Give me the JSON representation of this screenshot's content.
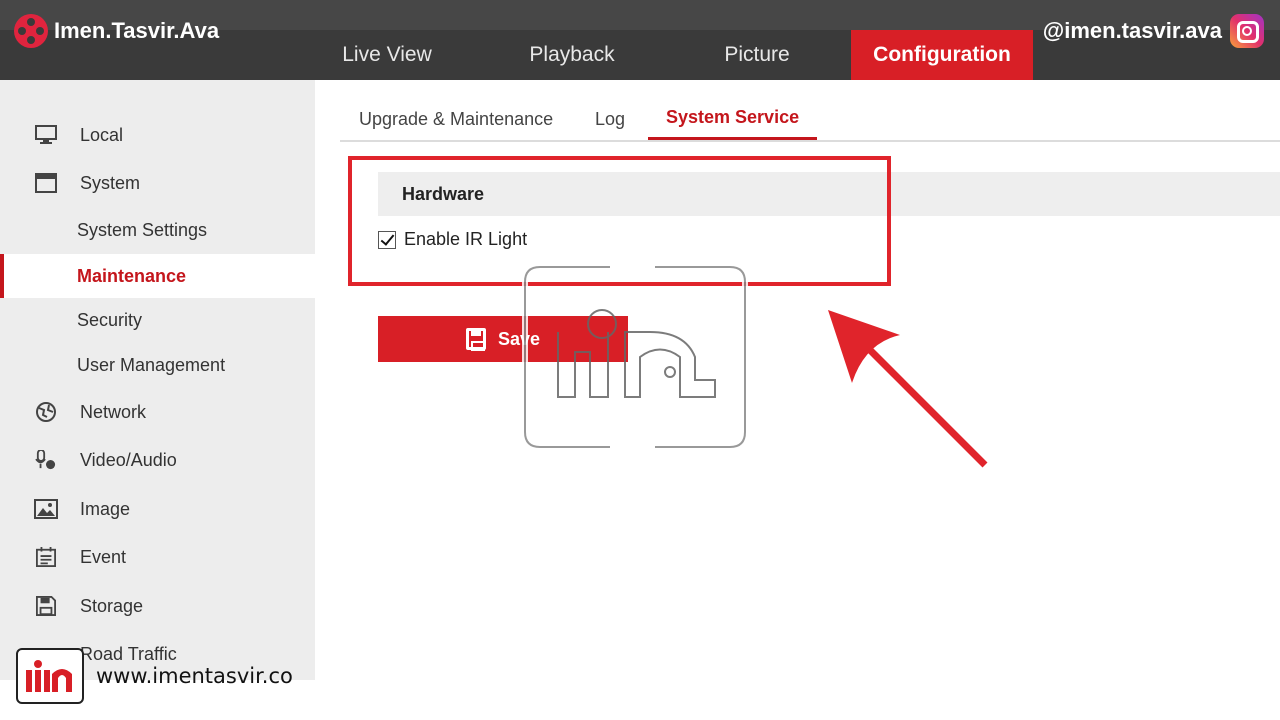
{
  "brand": {
    "name": "Imen.Tasvir.Ava",
    "handle": "@imen.tasvir.ava",
    "accent": "#d81f26"
  },
  "nav": {
    "items": [
      {
        "label": "Live View"
      },
      {
        "label": "Playback"
      },
      {
        "label": "Picture"
      },
      {
        "label": "Configuration",
        "active": true
      }
    ]
  },
  "sidebar": {
    "items": [
      {
        "label": "Local",
        "icon": "monitor-icon"
      },
      {
        "label": "System",
        "icon": "window-icon"
      },
      {
        "label": "System Settings"
      },
      {
        "label": "Maintenance",
        "active": true
      },
      {
        "label": "Security"
      },
      {
        "label": "User Management"
      },
      {
        "label": "Network",
        "icon": "globe-icon"
      },
      {
        "label": "Video/Audio",
        "icon": "microphone-icon"
      },
      {
        "label": "Image",
        "icon": "image-icon"
      },
      {
        "label": "Event",
        "icon": "calendar-icon"
      },
      {
        "label": "Storage",
        "icon": "floppy-icon"
      },
      {
        "label": "Road Traffic",
        "icon": "car-icon"
      }
    ]
  },
  "tabs": [
    {
      "label": "Upgrade & Maintenance"
    },
    {
      "label": "Log"
    },
    {
      "label": "System Service",
      "active": true
    }
  ],
  "section": {
    "title": "Hardware"
  },
  "checkbox": {
    "label": "Enable IR Light",
    "checked": true
  },
  "save": {
    "label": "Save"
  },
  "footer": {
    "url": "www.imentasvir.co"
  }
}
